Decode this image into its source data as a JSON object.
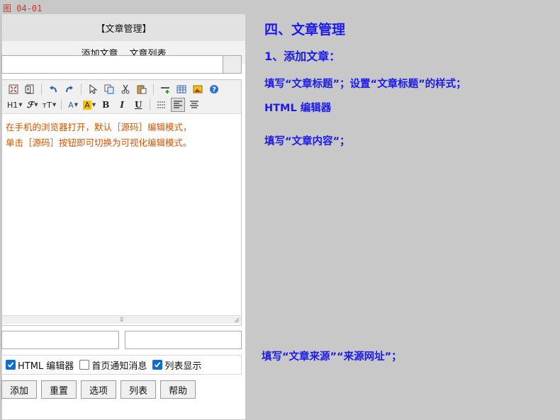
{
  "figure_label": "图 04-01",
  "panel": {
    "title": "【文章管理】",
    "nav": [
      {
        "label": "添加文章"
      },
      {
        "label": "文章列表"
      }
    ]
  },
  "form": {
    "article_title_value": "",
    "source_value": "",
    "source_url_value": ""
  },
  "editor": {
    "toolbar_row1": [
      "fullscreen-icon",
      "source-icon",
      "undo-icon",
      "redo-icon",
      "select-all-icon",
      "copy-icon",
      "cut-icon",
      "paste-icon",
      "hr-icon",
      "table-icon",
      "image-icon",
      "help-icon"
    ],
    "toolbar_row2": {
      "heading": "H1",
      "font": "ℱ",
      "size": "ᴛT",
      "color": "A",
      "highlight": "A",
      "bold": "B",
      "italic": "I",
      "underline": "U"
    },
    "highlight_color": "#f5c400",
    "content_line1": "在手机的浏览器打开，默认［源码］编辑模式，",
    "content_line2": "单击［源码］按钮即可切换为可视化编辑模式。"
  },
  "options": [
    {
      "label": "HTML 编辑器",
      "checked": true
    },
    {
      "label": "首页通知消息",
      "checked": false
    },
    {
      "label": "列表显示",
      "checked": true
    }
  ],
  "buttons": {
    "add": "添加",
    "reset": "重置",
    "options": "选项",
    "list": "列表",
    "help": "帮助"
  },
  "notes": {
    "heading": "四、文章管理",
    "subheading": "1、添加文章：",
    "title_note": "填写“文章标题”；设置“文章标题”的样式；",
    "editor_note": "HTML 编辑器",
    "content_note": "填写“文章内容”；",
    "source_note": "填写“文章来源”“来源网址”；"
  },
  "colors": {
    "note_text": "#1a1af0",
    "editor_text": "#d35400",
    "checkbox_on": "#0f6ecd"
  }
}
